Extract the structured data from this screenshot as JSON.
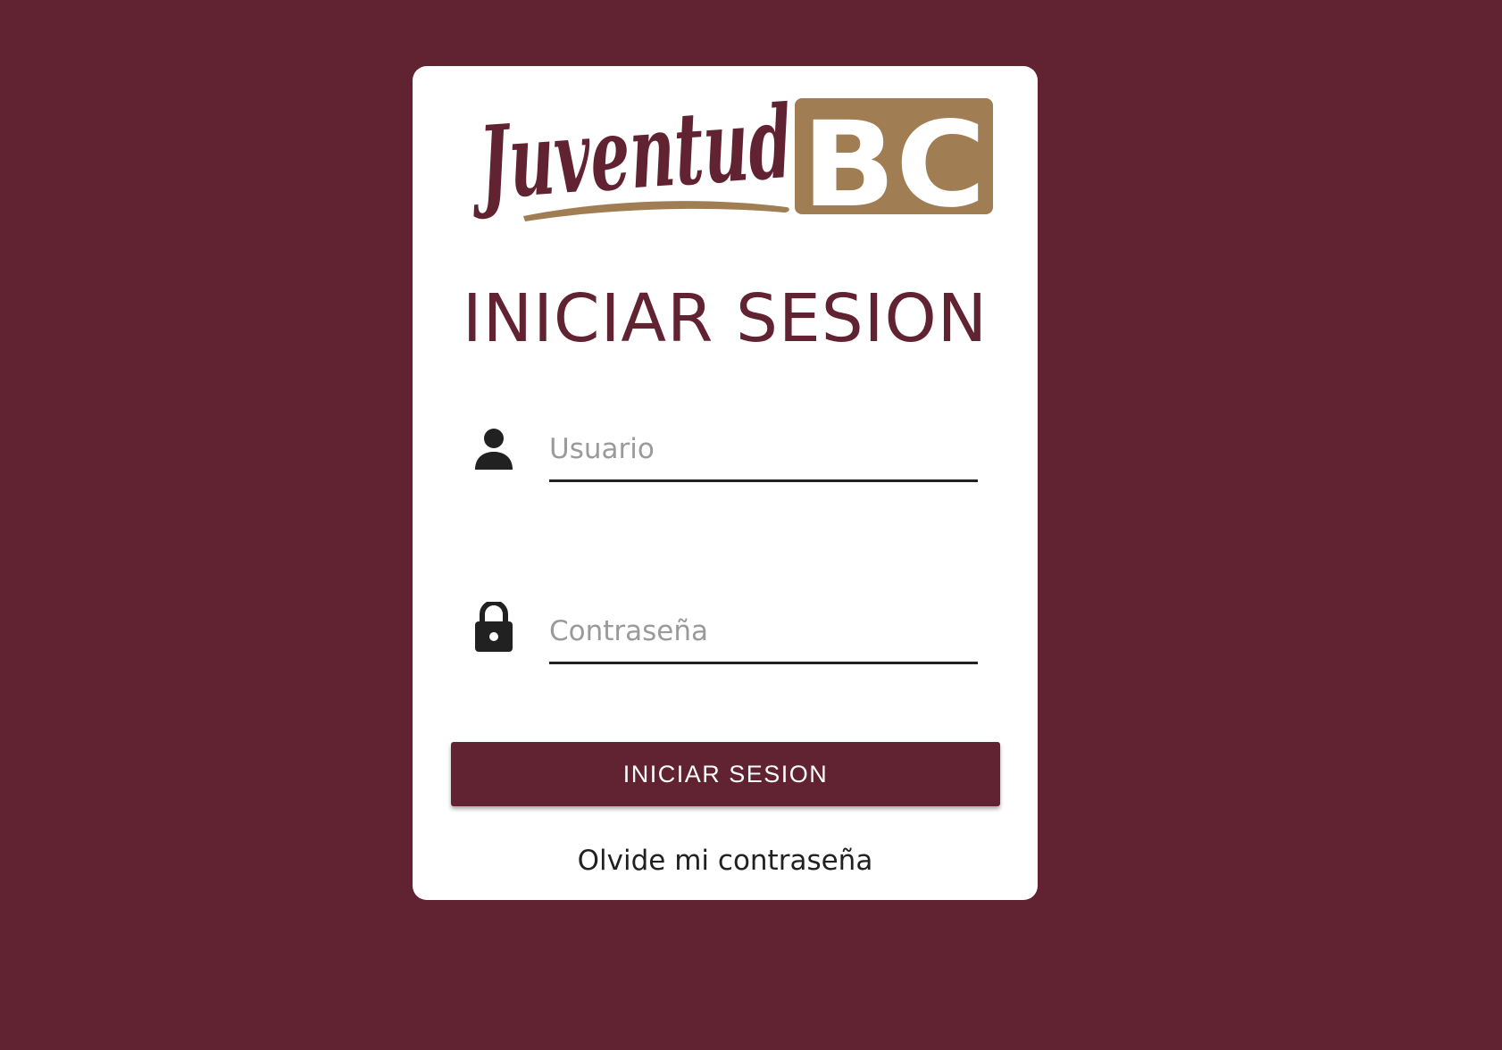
{
  "colors": {
    "background": "#612232",
    "card": "#ffffff",
    "primary": "#612232",
    "accent_gold": "#a07d52",
    "text_dark": "#212121",
    "placeholder": "#9a9a9a"
  },
  "logo": {
    "script_text": "Juventud",
    "block_text": "BC"
  },
  "login": {
    "title": "INICIAR SESION",
    "username": {
      "icon": "person-icon",
      "placeholder": "Usuario",
      "value": ""
    },
    "password": {
      "icon": "lock-icon",
      "placeholder": "Contraseña",
      "value": ""
    },
    "submit_label": "INICIAR SESION",
    "forgot_label": "Olvide mi contraseña"
  }
}
